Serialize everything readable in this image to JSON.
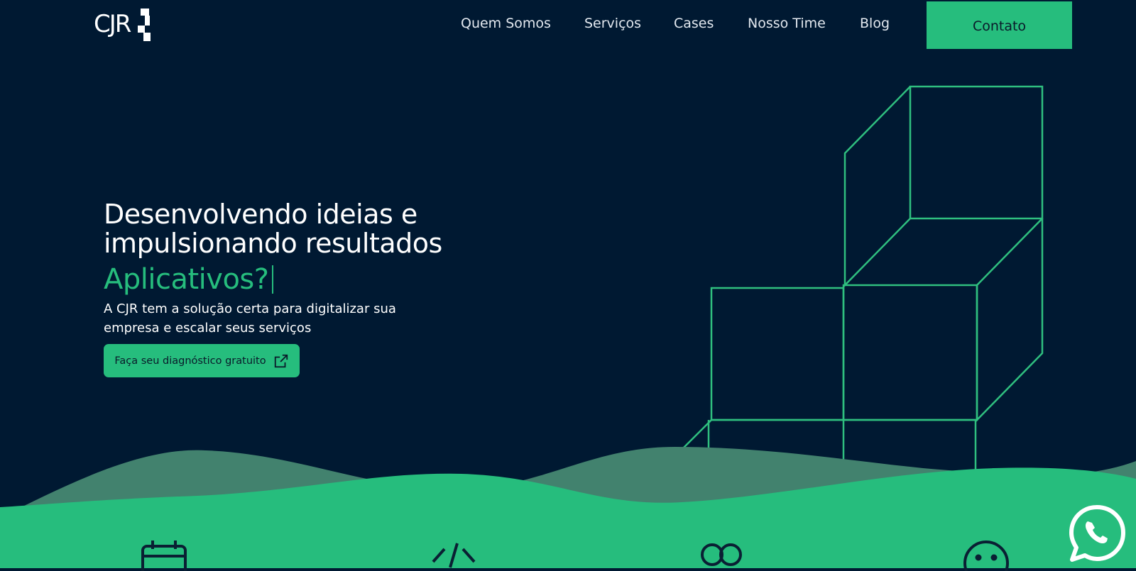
{
  "brand": {
    "logo_text": "CJR",
    "accent": "#26bd7d",
    "background": "#001932",
    "wave_light": "#42826e"
  },
  "nav": {
    "items": [
      {
        "label": "Quem Somos"
      },
      {
        "label": "Serviços"
      },
      {
        "label": "Cases"
      },
      {
        "label": "Nosso Time"
      },
      {
        "label": "Blog"
      }
    ],
    "contact_label": "Contato"
  },
  "hero": {
    "title": "Desenvolvendo ideias e impulsionando resultados",
    "typed_word": "Aplicativos?",
    "subtitle": "A CJR tem a solução certa para digitalizar sua empresa e escalar seus serviços",
    "cta_label": "Faça seu diagnóstico gratuito",
    "cta_icon": "external-link-icon"
  },
  "features": {
    "icons": [
      "calendar-icon",
      "code-icon",
      "people-icon",
      "smile-icon"
    ]
  },
  "floating": {
    "icon": "whatsapp-icon"
  }
}
